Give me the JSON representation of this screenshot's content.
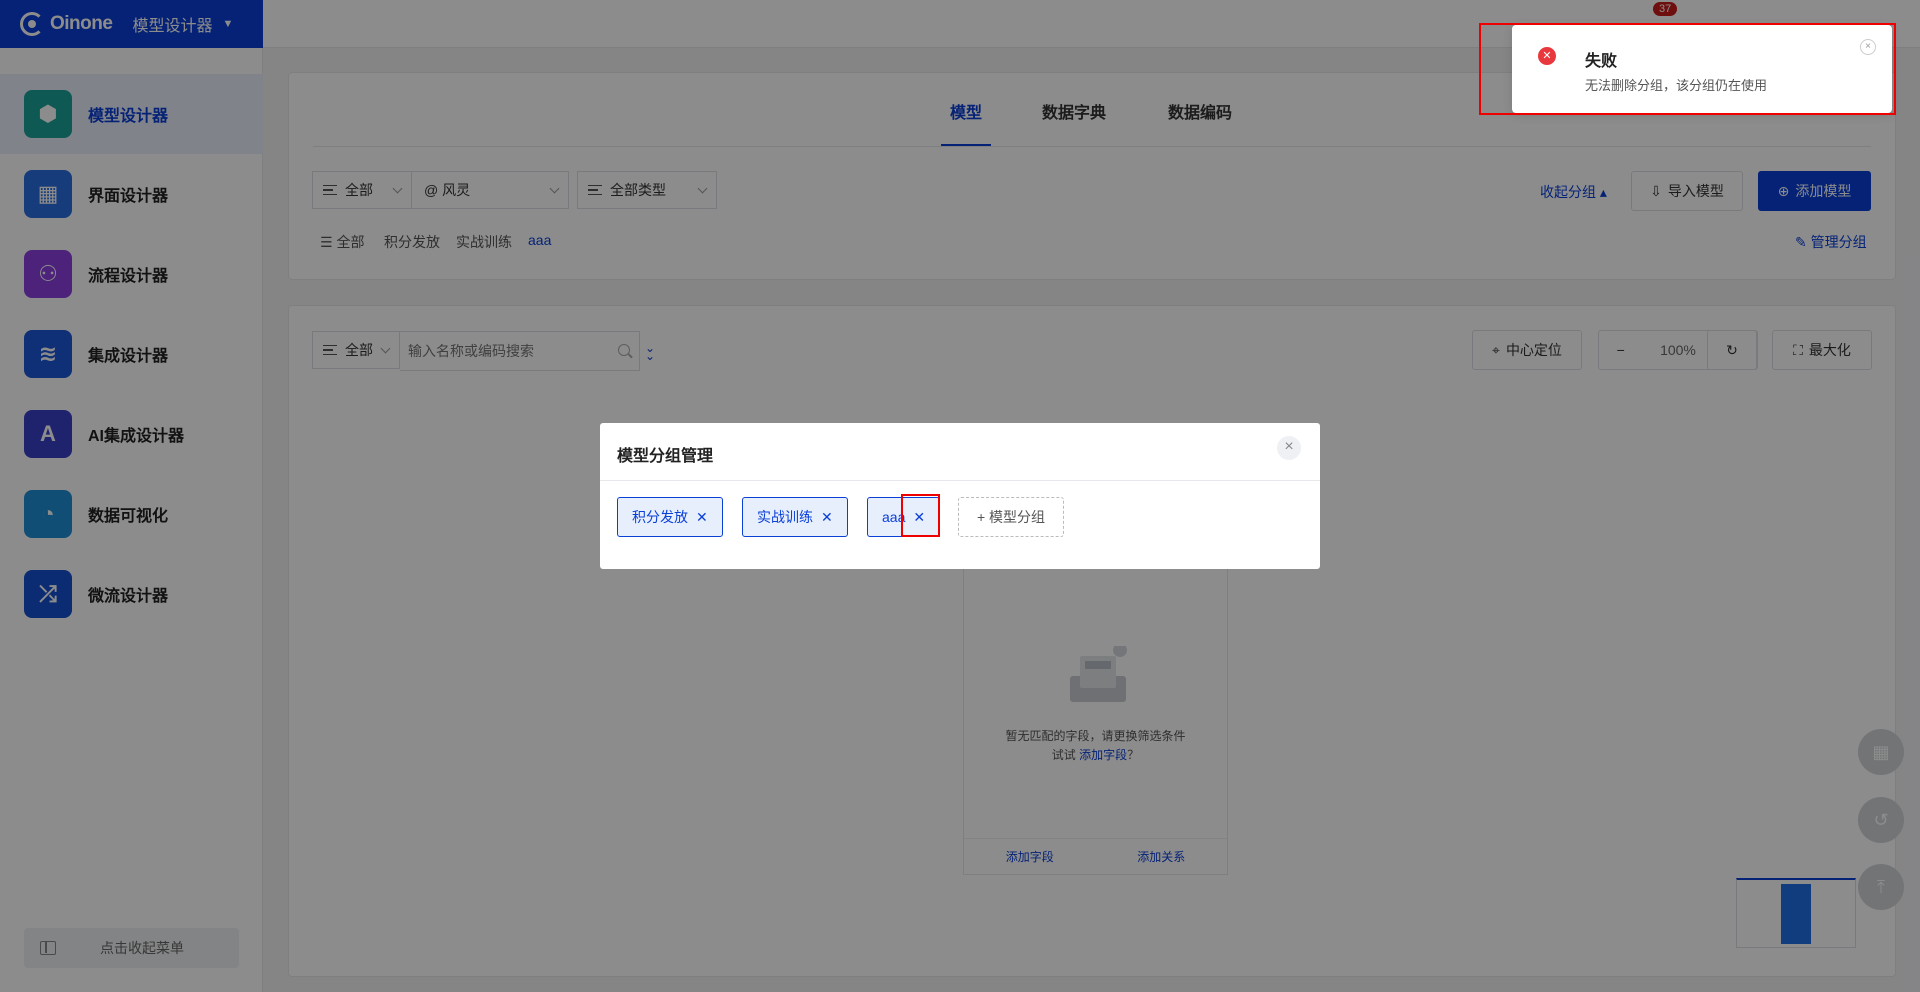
{
  "header": {
    "brand": "Oinone",
    "app_switcher": "模型设计器",
    "notification_count": "37"
  },
  "sidebar": {
    "items": [
      {
        "label": "模型设计器",
        "icon": "cube-icon",
        "color": "#1aa39a"
      },
      {
        "label": "界面设计器",
        "icon": "layout-icon",
        "color": "#2b6de0"
      },
      {
        "label": "流程设计器",
        "icon": "workflow-icon",
        "color": "#8a3fe0"
      },
      {
        "label": "集成设计器",
        "icon": "layers-icon",
        "color": "#1d56d8"
      },
      {
        "label": "AI集成设计器",
        "icon": "ai-icon",
        "color": "#3a40c8"
      },
      {
        "label": "数据可视化",
        "icon": "pie-chart-icon",
        "color": "#1e8fd8"
      },
      {
        "label": "微流设计器",
        "icon": "shuffle-icon",
        "color": "#1450d0"
      }
    ],
    "collapse_label": "点击收起菜单"
  },
  "tabs": [
    "模型",
    "数据字典",
    "数据编码"
  ],
  "filters": {
    "scope": "全部",
    "module": "@ 风灵",
    "type": "全部类型"
  },
  "groups": [
    "全部",
    "积分发放",
    "实战训练",
    "aaa"
  ],
  "actions": {
    "collapse_groups": "收起分组",
    "import_model": "导入模型",
    "add_model": "添加模型",
    "manage_groups": "管理分组"
  },
  "canvas": {
    "scope": "全部",
    "search_placeholder": "输入名称或编码搜索",
    "center_locate": "中心定位",
    "zoom": "100%",
    "maximize": "最大化"
  },
  "empty_card": {
    "line1": "暂无匹配的字段，请更换筛选条件",
    "line2_prefix": "试试",
    "line2_link": "添加字段",
    "line2_suffix": "？",
    "add_field": "添加字段",
    "add_relation": "添加关系"
  },
  "modal": {
    "title": "模型分组管理",
    "tags": [
      "积分发放",
      "实战训练",
      "aaa"
    ],
    "add_label": "+ 模型分组"
  },
  "toast": {
    "title": "失败",
    "message": "无法删除分组，该分组仍在使用"
  }
}
